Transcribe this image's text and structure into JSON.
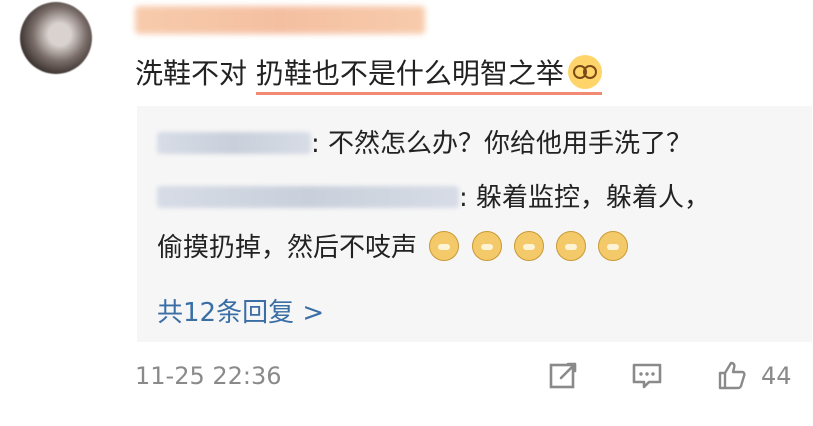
{
  "comment": {
    "prefix": "洗鞋不对 ",
    "highlight": "扔鞋也不是什么明智之举",
    "emoji": "smiling-face-with-glasses"
  },
  "replies": [
    {
      "text": ": 不然怎么办？你给他用手洗了？"
    },
    {
      "text": ": 躲着监控，躲着人，",
      "continuation": "偷摸扔掉，然后不吱声"
    }
  ],
  "reply_emoji_count": 5,
  "more_replies_label": "共12条回复 >",
  "footer": {
    "timestamp": "11-25 22:36",
    "like_count": "44"
  },
  "icons": {
    "share": "share-icon",
    "comment": "comment-icon",
    "like": "thumbs-up-icon"
  },
  "colors": {
    "link": "#3a6ea5",
    "underline": "#f08a73",
    "reply_background": "#f6f6f6"
  }
}
